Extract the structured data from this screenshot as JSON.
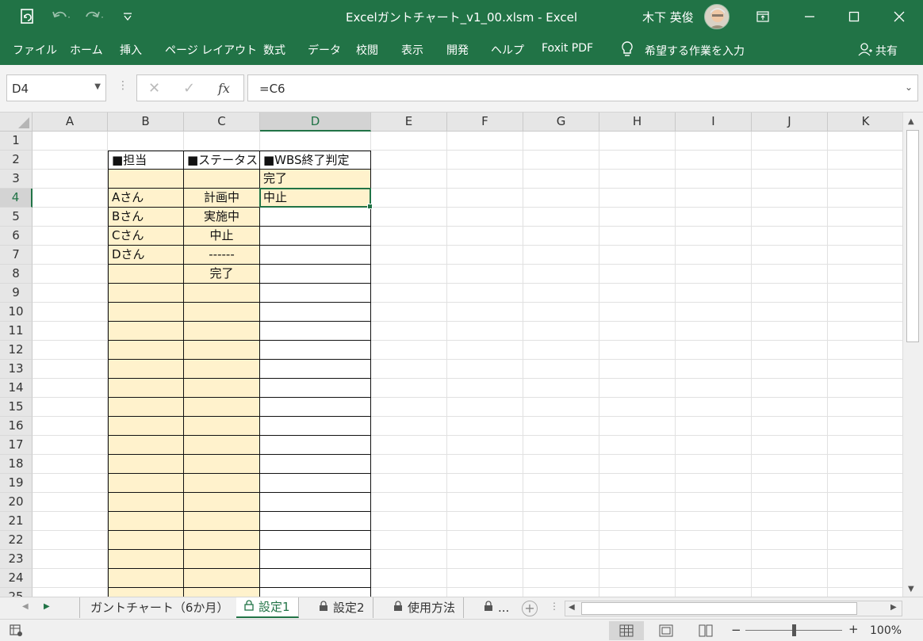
{
  "titlebar": {
    "title": "Excelガントチャート_v1_00.xlsm  -  Excel",
    "user": "木下 英俊",
    "accent": "#217346"
  },
  "ribbon": {
    "tabs": [
      "ファイル",
      "ホーム",
      "挿入",
      "ページ レイアウト",
      "数式",
      "データ",
      "校閲",
      "表示",
      "開発",
      "ヘルプ",
      "Foxit PDF"
    ],
    "tell_me": "希望する作業を入力",
    "share": "共有"
  },
  "formula_bar": {
    "name_box": "D4",
    "formula": "=C6",
    "fx": "fx"
  },
  "grid": {
    "columns": [
      "A",
      "B",
      "C",
      "D",
      "E",
      "F",
      "G",
      "H",
      "I",
      "J",
      "K"
    ],
    "rows": [
      "1",
      "2",
      "3",
      "4",
      "5",
      "6",
      "7",
      "8",
      "9",
      "10",
      "11",
      "12",
      "13",
      "14",
      "15",
      "16",
      "17",
      "18",
      "19",
      "20",
      "21",
      "22",
      "23",
      "24",
      "25"
    ],
    "selected_cell": "D4",
    "cells": {
      "B2": "■担当",
      "C2": "■ステータス",
      "D2": "■WBS終了判定",
      "D3": "完了",
      "B4": "Aさん",
      "C4": "計画中",
      "D4": "中止",
      "B5": "Bさん",
      "C5": "実施中",
      "B6": "Cさん",
      "C6": "中止",
      "B7": "Dさん",
      "C7": "------",
      "C8": "完了"
    },
    "fill_color": "#fff2cc"
  },
  "sheet_tabs": {
    "tabs": [
      {
        "label": "ガントチャート（6か月）",
        "locked": false,
        "active": false
      },
      {
        "label": "設定1",
        "locked": true,
        "active": true
      },
      {
        "label": "設定2",
        "locked": true,
        "active": false
      },
      {
        "label": "使用方法",
        "locked": true,
        "active": false
      },
      {
        "label": "...",
        "locked": true,
        "active": false
      }
    ],
    "add_label": "+"
  },
  "statusbar": {
    "zoom": "100%",
    "zoom_minus": "−",
    "zoom_plus": "+"
  }
}
